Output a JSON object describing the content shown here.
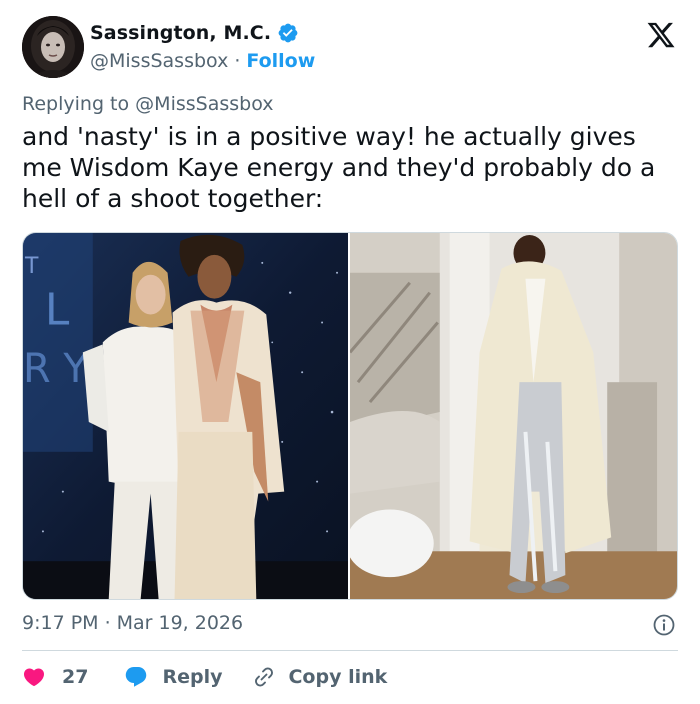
{
  "author": {
    "name": "Sassington, M.C.",
    "handle": "@MissSassbox",
    "separator": "·",
    "follow_label": "Follow"
  },
  "reply_context": {
    "prefix": "Replying to",
    "mention": "@MissSassbox"
  },
  "tweet": {
    "text": "and 'nasty' is in a positive way! he actually gives me Wisdom Kaye energy and they'd probably do a hell of a shoot together:"
  },
  "meta": {
    "time": "9:17 PM",
    "separator": "·",
    "date": "Mar 19, 2026"
  },
  "actions": {
    "like_count": "27",
    "reply_label": "Reply",
    "copy_label": "Copy link"
  },
  "colors": {
    "accent": "#1d9bf0",
    "like": "#f91880",
    "text": "#0f1419",
    "muted": "#536471",
    "border": "#cfd9de"
  },
  "icons": [
    "verified-badge-icon",
    "x-logo-icon",
    "info-icon",
    "heart-icon",
    "reply-bubble-icon",
    "link-icon"
  ]
}
